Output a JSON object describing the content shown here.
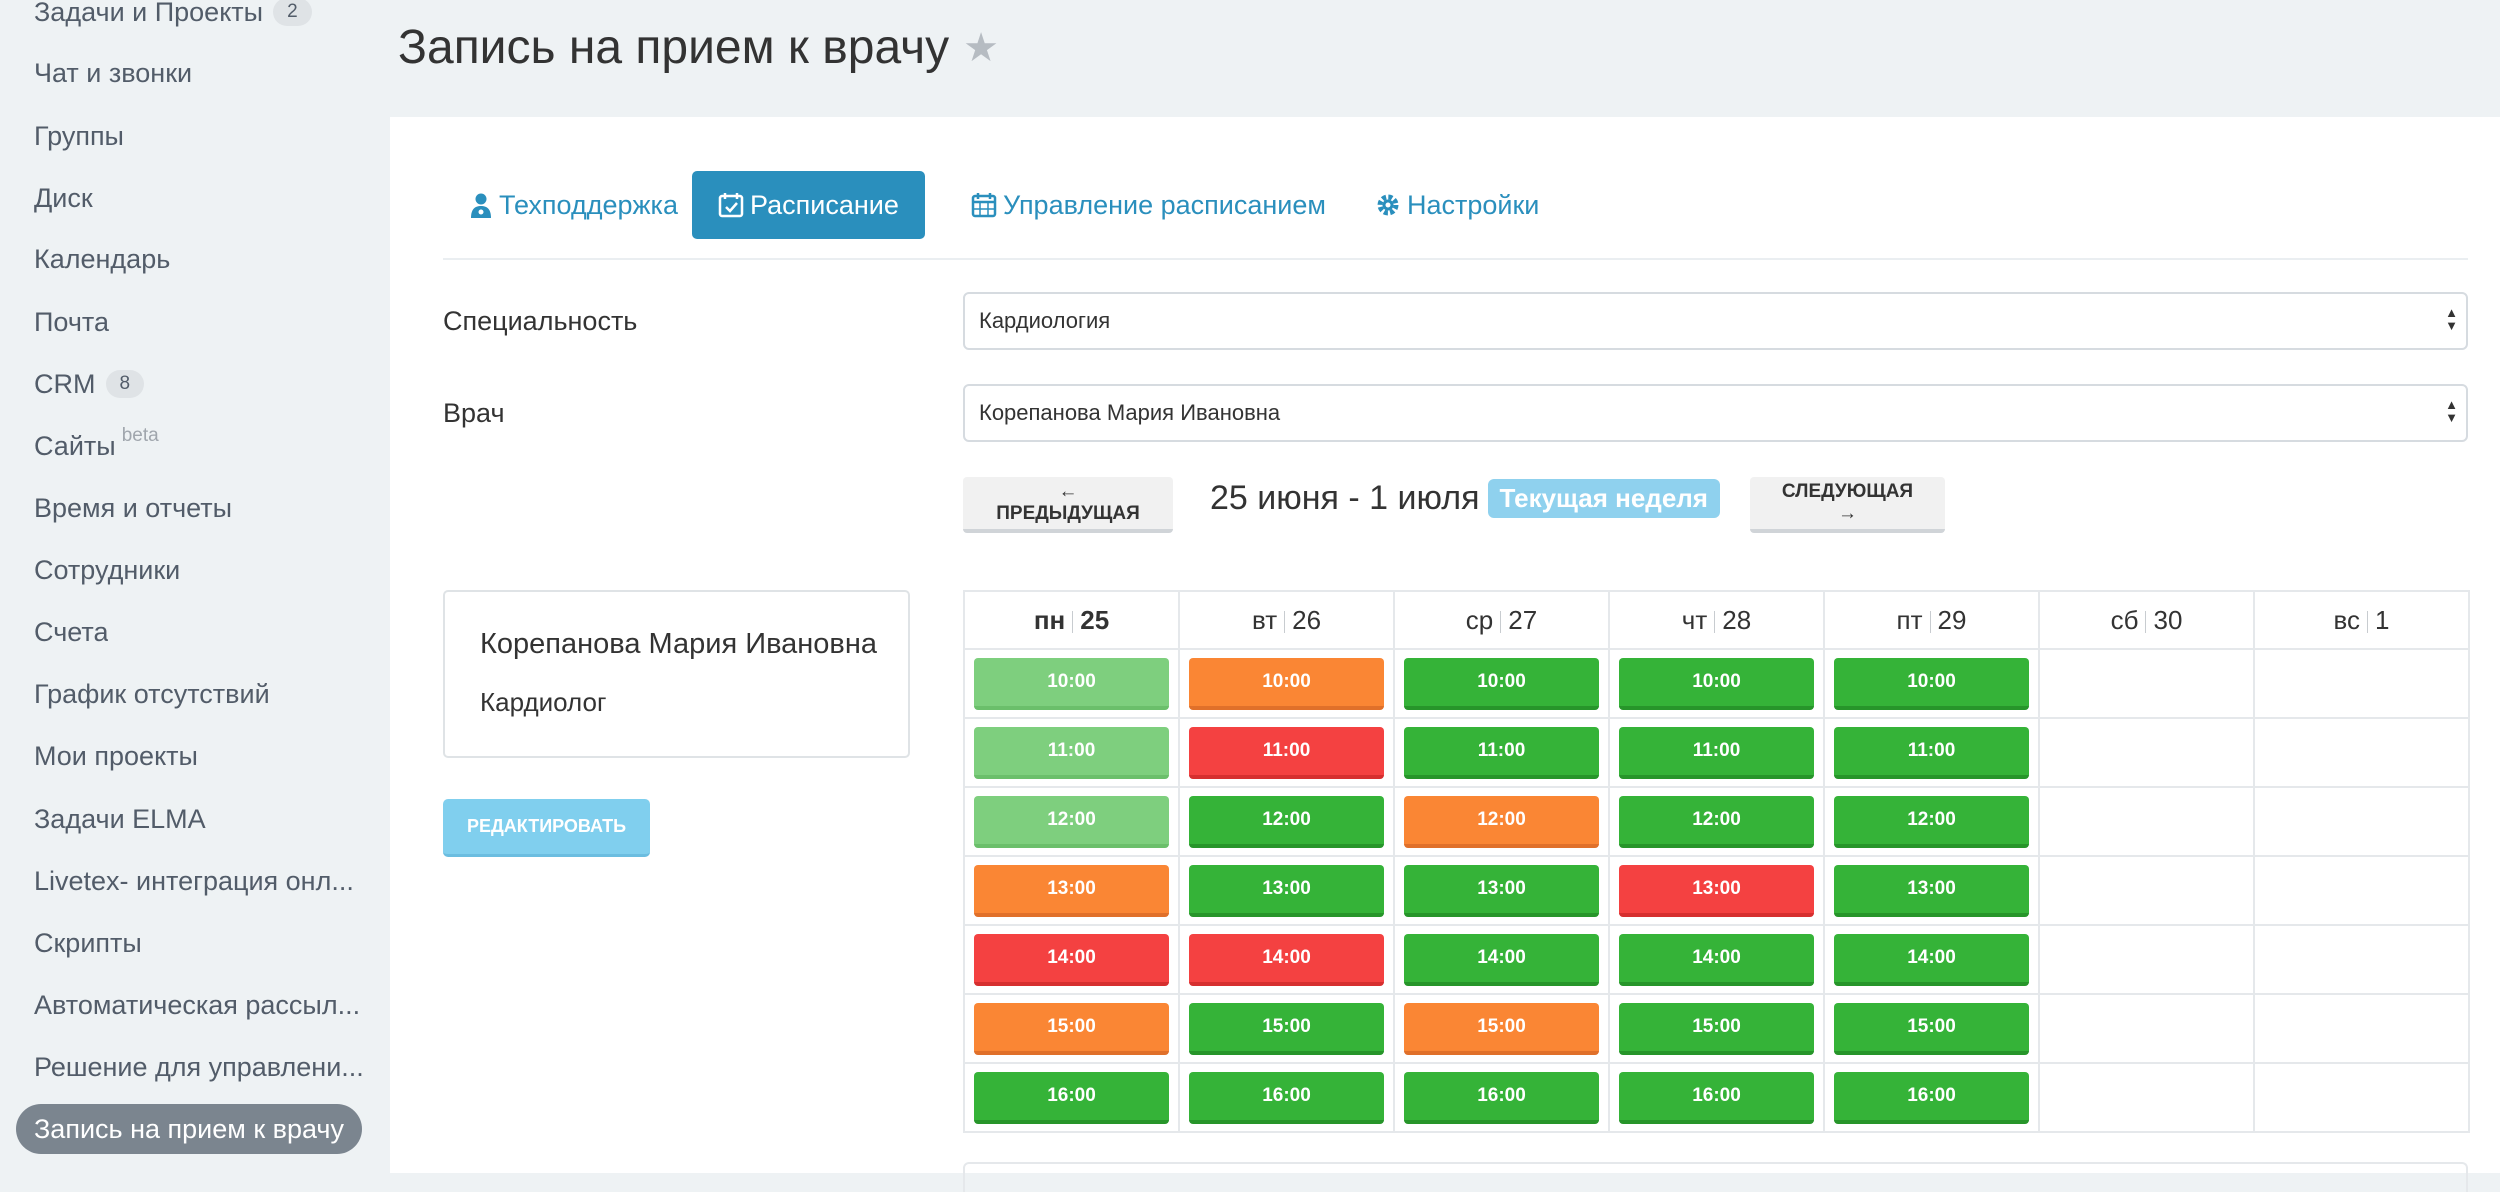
{
  "sidebar": {
    "items": [
      {
        "label": "Задачи и Проекты",
        "badge": "2"
      },
      {
        "label": "Чат и звонки"
      },
      {
        "label": "Группы"
      },
      {
        "label": "Диск"
      },
      {
        "label": "Календарь"
      },
      {
        "label": "Почта"
      },
      {
        "label": "CRM",
        "badge": "8"
      },
      {
        "label": "Сайты",
        "sup": "beta"
      },
      {
        "label": "Время и отчеты"
      },
      {
        "label": "Сотрудники"
      },
      {
        "label": "Счета"
      },
      {
        "label": "График отсутствий"
      },
      {
        "label": "Мои проекты"
      },
      {
        "label": "Задачи ELMA"
      },
      {
        "label": "Livetex- интеграция онл..."
      },
      {
        "label": "Скрипты"
      },
      {
        "label": "Автоматическая рассыл..."
      },
      {
        "label": "Решение для управлени..."
      },
      {
        "label": "Запись на прием к врачу",
        "active": true
      }
    ]
  },
  "header": {
    "title": "Запись на прием к врачу",
    "star": "★"
  },
  "tabs": [
    {
      "label": "Техподдержка",
      "icon": "user-doctor-icon"
    },
    {
      "label": "Расписание",
      "icon": "calendar-check-icon",
      "active": true
    },
    {
      "label": "Управление расписанием",
      "icon": "calendar-icon"
    },
    {
      "label": "Настройки",
      "icon": "gear-icon"
    }
  ],
  "form": {
    "specialty_label": "Специальность",
    "specialty_value": "Кардиология",
    "doctor_label": "Врач",
    "doctor_value": "Корепанова Мария Ивановна"
  },
  "week_nav": {
    "prev_label": "← ПРЕДЫДУЩАЯ",
    "range": "25 июня - 1 июля",
    "current_badge": "Текущая неделя",
    "next_label": "СЛЕДУЮЩАЯ →"
  },
  "doctor_card": {
    "name": "Корепанова Мария Ивановна",
    "specialty": "Кардиолог"
  },
  "edit_label": "РЕДАКТИРОВАТЬ",
  "schedule": {
    "days": [
      {
        "dow": "пн",
        "date": "25",
        "today": true
      },
      {
        "dow": "вт",
        "date": "26"
      },
      {
        "dow": "ср",
        "date": "27"
      },
      {
        "dow": "чт",
        "date": "28"
      },
      {
        "dow": "пт",
        "date": "29"
      },
      {
        "dow": "сб",
        "date": "30"
      },
      {
        "dow": "вс",
        "date": "1"
      }
    ],
    "times": [
      "10:00",
      "11:00",
      "12:00",
      "13:00",
      "14:00",
      "15:00",
      "16:00"
    ],
    "status_colors": {
      "free": "#35b338",
      "past": "#7ecf7e",
      "pending": "#fa8634",
      "busy": "#f44141"
    },
    "slots": [
      [
        "past",
        "pending",
        "free",
        "free",
        "free",
        null,
        null
      ],
      [
        "past",
        "busy",
        "free",
        "free",
        "free",
        null,
        null
      ],
      [
        "past",
        "free",
        "pending",
        "free",
        "free",
        null,
        null
      ],
      [
        "pending",
        "free",
        "free",
        "busy",
        "free",
        null,
        null
      ],
      [
        "busy",
        "busy",
        "free",
        "free",
        "free",
        null,
        null
      ],
      [
        "pending",
        "free",
        "pending",
        "free",
        "free",
        null,
        null
      ],
      [
        "free",
        "free",
        "free",
        "free",
        "free",
        null,
        null
      ]
    ]
  }
}
